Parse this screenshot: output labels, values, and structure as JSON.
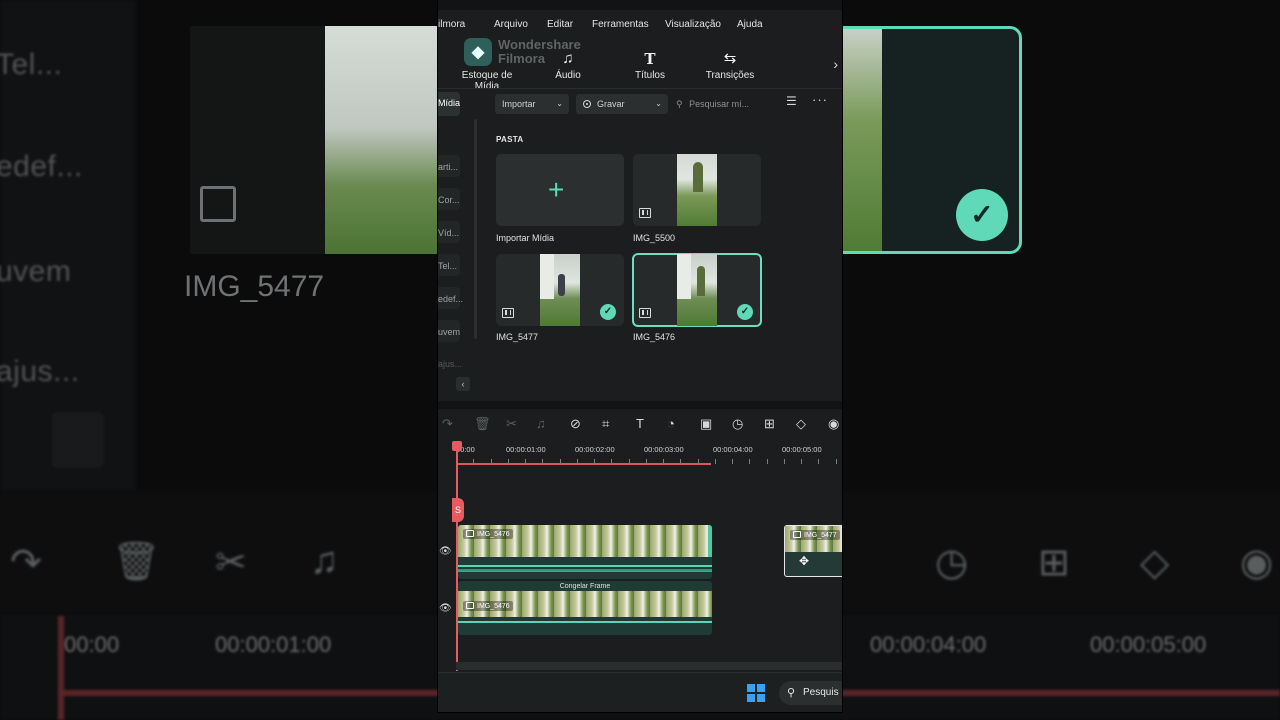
{
  "menu": {
    "app_fragment": "ilmora",
    "items": [
      "Arquivo",
      "Editar",
      "Ferramentas",
      "Visualização",
      "Ajuda"
    ]
  },
  "logo": {
    "line1": "Wondershare",
    "line2": "Filmora"
  },
  "toolbar": {
    "items": [
      {
        "label": "Estoque de Mídia",
        "icon": "stock-media-icon"
      },
      {
        "label": "Áudio",
        "icon": "music-note-icon"
      },
      {
        "label": "Títulos",
        "icon": "title-t-icon"
      },
      {
        "label": "Transições",
        "icon": "transition-arrows-icon"
      }
    ]
  },
  "sidenav": {
    "selected": "Mídia",
    "items": [
      "arti...",
      "Cor...",
      "Víd...",
      "Tel...",
      "edef...",
      "uvem",
      "ajus..."
    ]
  },
  "media": {
    "import_label": "Importar",
    "record_label": "Gravar",
    "search_placeholder": "Pesquisar mí...",
    "folder_title": "PASTA",
    "cards": [
      {
        "label": "Importar Mídia",
        "selected": false,
        "checked": false
      },
      {
        "label": "IMG_5500",
        "selected": false,
        "checked": false
      },
      {
        "label": "IMG_5477",
        "selected": false,
        "checked": true
      },
      {
        "label": "IMG_5476",
        "selected": true,
        "checked": true
      }
    ]
  },
  "timeline": {
    "timecodes": [
      "00:00",
      "00:00:01:00",
      "00:00:02:00",
      "00:00:03:00",
      "00:00:04:00",
      "00:00:05:00"
    ],
    "clips": [
      {
        "title": "IMG_5476",
        "track": 2
      },
      {
        "title": "IMG_5476",
        "track": 1,
        "overlay": "Congelar Frame"
      },
      {
        "title": "IMG_5477",
        "track": 2
      }
    ]
  },
  "taskbar": {
    "search_label": "Pesquis"
  },
  "background": {
    "clip_name": "IMG_5477",
    "side_labels": [
      "Tel...",
      "edef...",
      "uvem",
      "ajus..."
    ],
    "timecodes": [
      "00:00",
      "00:00:01:00",
      "00:00:04:00",
      "00:00:05:00"
    ]
  },
  "colors": {
    "accent": "#5fd9b8",
    "playhead": "#e65a60",
    "panel": "#1b1d1e"
  }
}
